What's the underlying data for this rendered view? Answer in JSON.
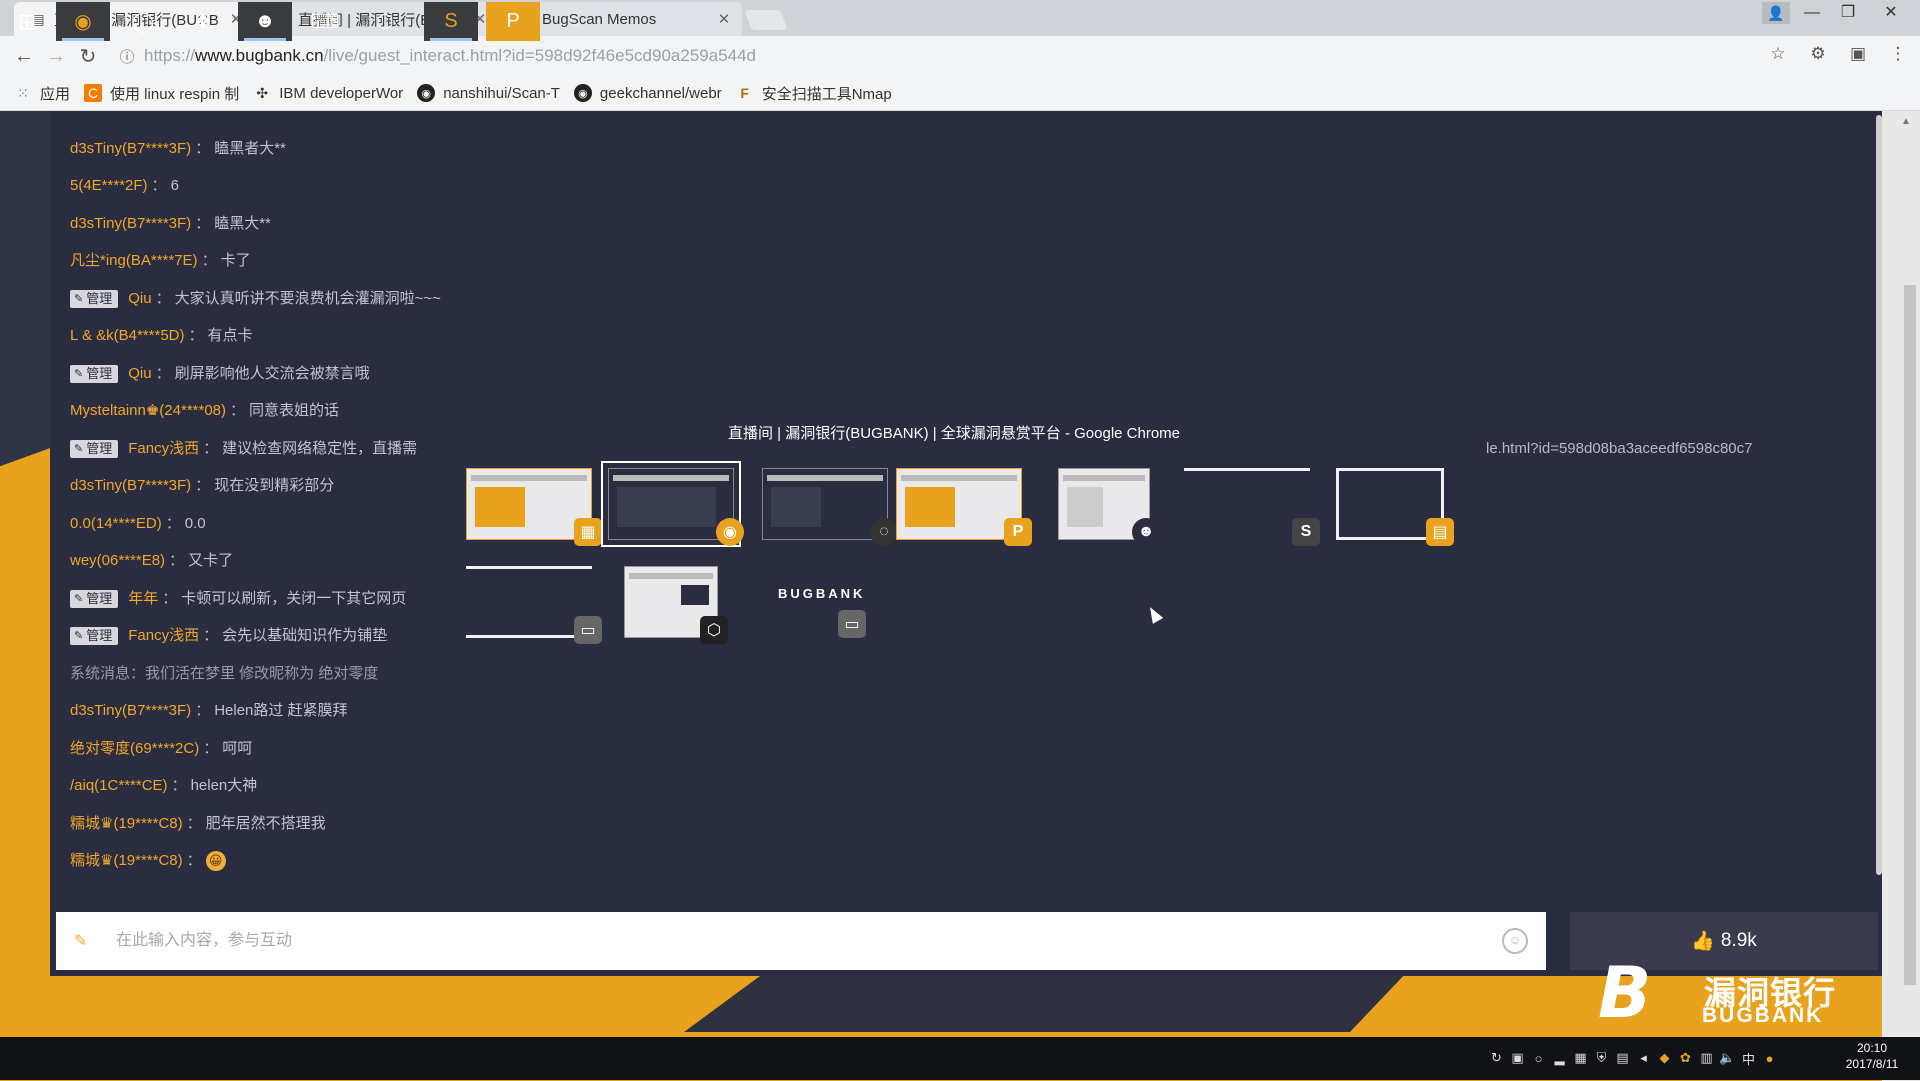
{
  "browser": {
    "tabs": [
      {
        "label": "直播间 | 漏洞银行(BUGB",
        "icon": "page-icon",
        "active": true
      },
      {
        "label": "直播间 | 漏洞银行(BUG",
        "icon": "page-icon",
        "active": false
      },
      {
        "label": "BugScan Memos",
        "icon": "search-icon",
        "active": false
      }
    ],
    "url": {
      "scheme": "https://",
      "host": "www.bugbank.cn",
      "path": "/live/guest_interact.html?id=598d92f46e5cd90a259a544d"
    },
    "bookmarks": [
      {
        "label": "应用",
        "icon": "apps-grid-icon"
      },
      {
        "label": "使用 linux respin 制",
        "icon": "c-logo-icon"
      },
      {
        "label": "IBM developerWor",
        "icon": "ibm-icon"
      },
      {
        "label": "nanshihui/Scan-T",
        "icon": "github-icon"
      },
      {
        "label": "geekchannel/webr",
        "icon": "github-icon"
      },
      {
        "label": "安全扫描工具Nmap",
        "icon": "f-logo-icon"
      }
    ]
  },
  "chat": {
    "messages": [
      {
        "user": "d3sTiny(B7****3F)",
        "text": "瞌黑者大**",
        "admin": false
      },
      {
        "user": "5(4E****2F)",
        "text": "6",
        "admin": false
      },
      {
        "user": "d3sTiny(B7****3F)",
        "text": "瞌黑大**",
        "admin": false
      },
      {
        "user": "凡尘*ing(BA****7E)",
        "text": "卡了",
        "admin": false
      },
      {
        "user": "Qiu",
        "text": "大家认真听讲不要浪费机会灌漏洞啦~~~",
        "admin": true
      },
      {
        "user": "L & &k(B4****5D)",
        "text": "有点卡",
        "admin": false
      },
      {
        "user": "Qiu",
        "text": "刷屏影响他人交流会被禁言哦",
        "admin": true
      },
      {
        "user": "Mysteltainn♚(24****08)",
        "text": "同意表姐的话",
        "admin": false
      },
      {
        "user": "Fancy浅西",
        "text": "建议检查网络稳定性，直播需",
        "admin": true
      },
      {
        "user": "d3sTiny(B7****3F)",
        "text": "现在没到精彩部分",
        "admin": false
      },
      {
        "user": "0.0(14****ED)",
        "text": "0.0",
        "admin": false
      },
      {
        "user": "wey(06****E8)",
        "text": "又卡了",
        "admin": false
      },
      {
        "user": "年年",
        "text": "卡顿可以刷新，关闭一下其它网页",
        "admin": true
      },
      {
        "user": "Fancy浅西",
        "text": "会先以基础知识作为铺垫",
        "admin": true
      },
      {
        "system": true,
        "text": "系统消息：我们活在梦里 修改昵称为 绝对零度"
      },
      {
        "user": "d3sTiny(B7****3F)",
        "text": "Helen路过 赶紧膜拜",
        "admin": false
      },
      {
        "user": "绝对零度(69****2C)",
        "text": "呵呵",
        "admin": false
      },
      {
        "user": "/aiq(1C****CE)",
        "text": "helen大神",
        "admin": false
      },
      {
        "user": "糯城♛(19****C8)",
        "text": "肥年居然不搭理我",
        "admin": false
      },
      {
        "user": "糯城♛(19****C8)",
        "text": "😀",
        "admin": false
      }
    ],
    "admin_badge": "管理",
    "separator": "：",
    "input_placeholder": "在此输入内容，参与互动",
    "like_count": "8.9k"
  },
  "switcher": {
    "title": "直播间 | 漏洞银行(BUGBANK) | 全球漏洞悬赏平台 - Google Chrome",
    "url_fragment": "le.html?id=598d08ba3aceedf6598c80c7",
    "thumb_logo": "BUGBANK"
  },
  "logo": {
    "cn": "漏洞银行",
    "en": "BUGBANK"
  },
  "taskbar": {
    "clock_time": "20:10",
    "clock_date": "2017/8/11",
    "ime": "中"
  },
  "colors": {
    "accent": "#e9a21e",
    "panel": "#2a2c40",
    "username": "#f0a82a"
  }
}
